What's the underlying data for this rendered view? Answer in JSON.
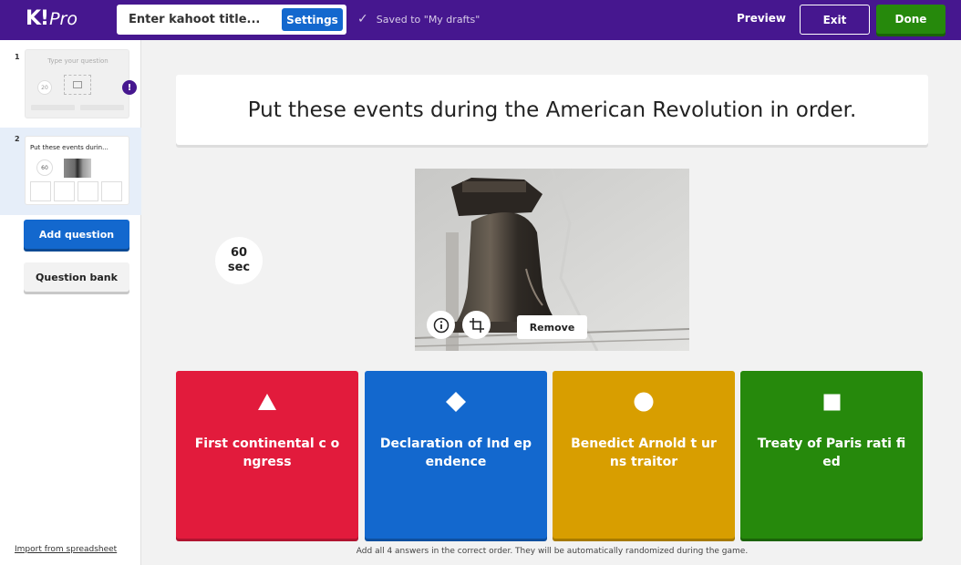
{
  "app": {
    "logo_letter": "K!",
    "logo_suffix": "Pro"
  },
  "header": {
    "title_placeholder": "Enter kahoot title...",
    "settings_label": "Settings",
    "saved_status": "Saved to \"My drafts\"",
    "preview_label": "Preview",
    "exit_label": "Exit",
    "done_label": "Done"
  },
  "sidebar": {
    "slides": [
      {
        "number": "1",
        "preview_text": "Type your question",
        "timer": "20",
        "has_warning": true,
        "warning_symbol": "!"
      },
      {
        "number": "2",
        "preview_text": "Put these events durin...",
        "timer": "60",
        "has_warning": false
      }
    ],
    "add_question_label": "Add question",
    "question_bank_label": "Question bank",
    "import_label": "Import from spreadsheet"
  },
  "question": {
    "text": "Put these events during the American Revolution in order.",
    "time_limit_value": "60",
    "time_limit_unit": "sec",
    "remove_media_label": "Remove"
  },
  "answers": [
    {
      "shape": "triangle-icon",
      "text": "First continental c ongress",
      "color": "#e21b3c"
    },
    {
      "shape": "diamond-icon",
      "text": "Declaration of Ind ependence",
      "color": "#1368ce"
    },
    {
      "shape": "circle-icon",
      "text": "Benedict Arnold t urns traitor",
      "color": "#d89e00"
    },
    {
      "shape": "square-icon",
      "text": "Treaty of Paris rati fied",
      "color": "#26890c"
    }
  ],
  "footer_note": "Add all 4 answers in the correct order. They will be automatically randomized during the game.",
  "colors": {
    "brand_purple": "#46178f",
    "primary_blue": "#1368ce",
    "done_green": "#26890c"
  }
}
